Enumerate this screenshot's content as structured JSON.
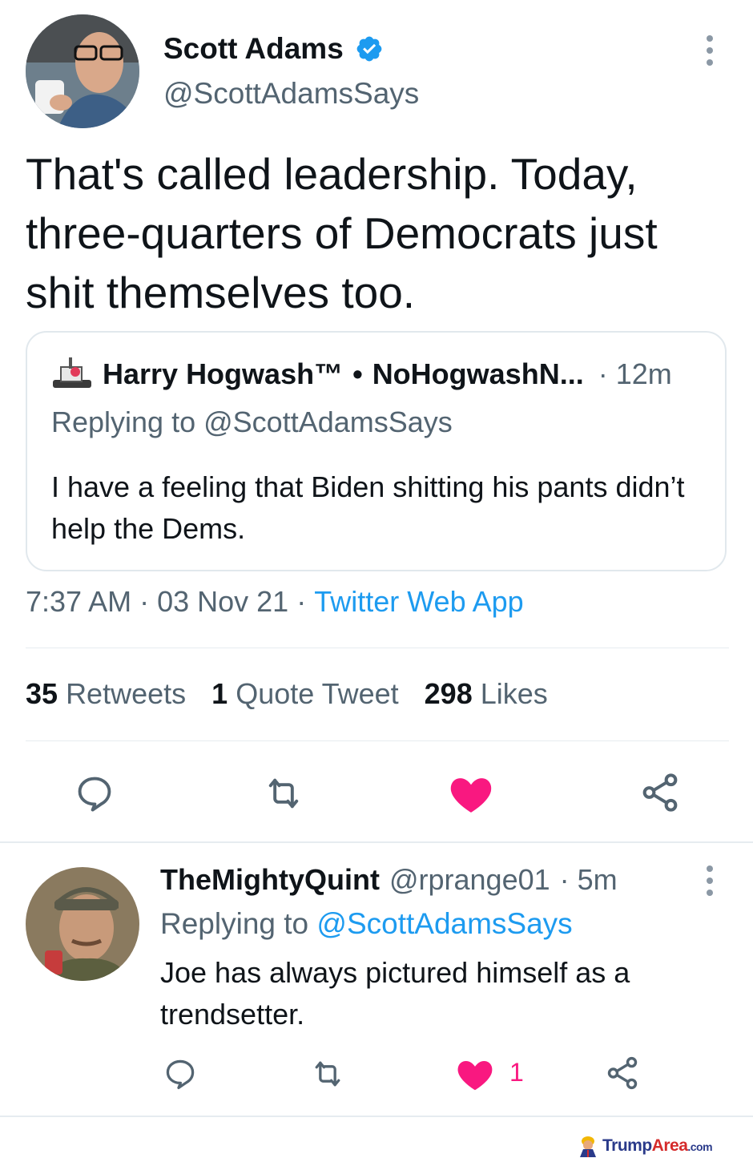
{
  "main_tweet": {
    "author_name": "Scott Adams",
    "author_handle": "@ScottAdamsSays",
    "verified": true,
    "text": "That's called leadership. Today, three-quarters of Democrats just shit themselves too.",
    "quoted": {
      "author_name": "Harry Hogwash™",
      "separator": "•",
      "author_handle": "NoHogwashN...",
      "time": "· 12m",
      "replying_prefix": "Replying to",
      "replying_handle": "@ScottAdamsSays",
      "text": "I have a feeling that Biden shitting his pants didn’t help the Dems."
    },
    "time": "7:37 AM",
    "dot1": "·",
    "date": "03 Nov 21",
    "dot2": "·",
    "source": "Twitter Web App",
    "stats": {
      "retweets_count": "35",
      "retweets_label": "Retweets",
      "quotes_count": "1",
      "quotes_label": "Quote Tweet",
      "likes_count": "298",
      "likes_label": "Likes"
    }
  },
  "reply": {
    "author_name": "TheMightyQuint",
    "author_handle": "@rprange01",
    "time": "· 5m",
    "replying_prefix": "Replying to",
    "replying_handle": "@ScottAdamsSays",
    "text": "Joe has always pictured himself as a trendsetter.",
    "like_count": "1"
  },
  "watermark": {
    "part1": "Trump",
    "part2": "Area",
    "part3": ".com"
  },
  "colors": {
    "accent": "#1d9bf0",
    "like": "#f91880",
    "text": "#0f1419",
    "muted": "#536471"
  },
  "icons": [
    "verified-badge-icon",
    "more-options-icon",
    "reply-icon",
    "retweet-icon",
    "like-icon",
    "share-icon"
  ]
}
